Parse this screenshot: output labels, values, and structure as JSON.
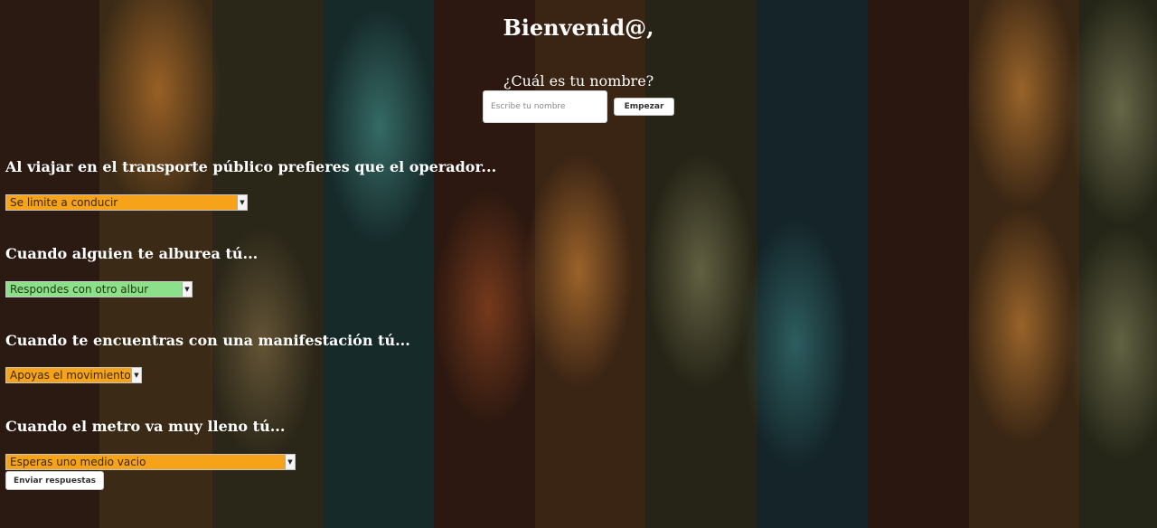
{
  "header": {
    "title": "Bienvenid@,",
    "name_question": "¿Cuál es tu nombre?",
    "name_placeholder": "Escribe tu nombre",
    "start_label": "Empezar"
  },
  "questions": [
    {
      "text": "Al viajar en el transporte público prefieres que el operador...",
      "selected": "Se limite a conducir",
      "color": "#f7a319"
    },
    {
      "text": "Cuando alguien te alburea tú...",
      "selected": "Respondes con otro albur",
      "color": "#8de08a"
    },
    {
      "text": "Cuando te encuentras con una manifestación tú...",
      "selected": "Apoyas el movimiento",
      "color": "#f7a319"
    },
    {
      "text": "Cuando el metro va muy lleno tú...",
      "selected": "Esperas uno medio vacio",
      "color": "#f7a319"
    }
  ],
  "submit_label": "Enviar respuestas",
  "icons": {
    "select_arrow": "chevron-down-icon"
  }
}
